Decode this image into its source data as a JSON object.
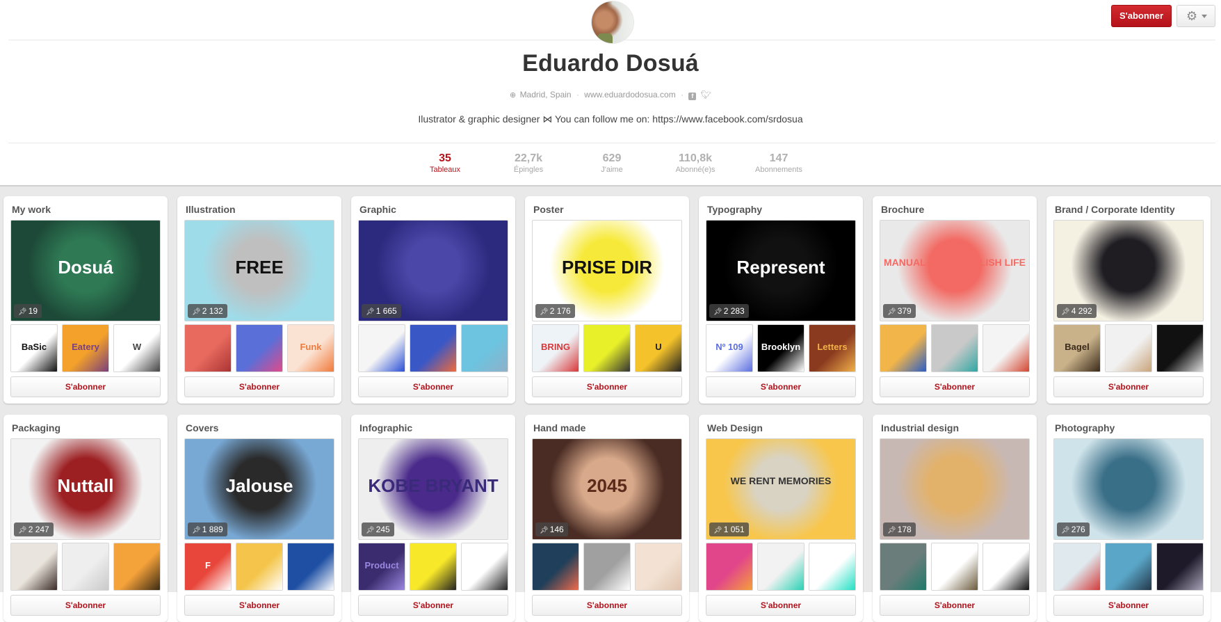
{
  "header": {
    "follow_label": "S'abonner",
    "settings_icon": "gear-icon",
    "avatar_icon": "profile-photo"
  },
  "profile": {
    "name": "Eduardo Dosuá",
    "location_icon": "globe-icon",
    "location": "Madrid, Spain",
    "website": "www.eduardodosua.com",
    "social_icons": [
      "facebook-icon",
      "twitter-icon"
    ],
    "bio": "Ilustrator & graphic designer ⋈ You can follow me on: https://www.facebook.com/srdosua"
  },
  "stats": [
    {
      "value": "35",
      "label": "Tableaux",
      "active": true
    },
    {
      "value": "22,7k",
      "label": "Épingles",
      "active": false
    },
    {
      "value": "629",
      "label": "J'aime",
      "active": false
    },
    {
      "value": "110,8k",
      "label": "Abonné(e)s",
      "active": false
    },
    {
      "value": "147",
      "label": "Abonnements",
      "active": false
    }
  ],
  "board_follow_label": "S'abonner",
  "pin_icon": "pushpin-icon",
  "boards": [
    {
      "title": "My work",
      "pins": "19",
      "cover_colors": [
        "#1d4a38",
        "#2f7a55"
      ],
      "cover_text": "Dosuá",
      "cover_text_color": "#ffffff",
      "thumbs": [
        [
          "#ffffff",
          "#111111",
          "BaSic"
        ],
        [
          "#f3a12a",
          "#7a3f7c",
          "Eatery"
        ],
        [
          "#ffffff",
          "#444444",
          "W"
        ]
      ]
    },
    {
      "title": "Illustration",
      "pins": "2 132",
      "cover_colors": [
        "#9fdcea",
        "#bfbfbf"
      ],
      "cover_text": "FREE",
      "cover_text_color": "#111111",
      "thumbs": [
        [
          "#e86a5f",
          "#a33",
          ""
        ],
        [
          "#5a6fd8",
          "#e04a8a",
          ""
        ],
        [
          "#fbe3d3",
          "#f07a3a",
          "Funk"
        ]
      ]
    },
    {
      "title": "Graphic",
      "pins": "1 665",
      "cover_colors": [
        "#2c2a7e",
        "#4a47a8"
      ],
      "cover_text": "",
      "cover_text_color": "#ffffff",
      "thumbs": [
        [
          "#f5f5f5",
          "#2a4fd6",
          ""
        ],
        [
          "#3a57c6",
          "#f06a3a",
          ""
        ],
        [
          "#6cc4e0",
          "#8fb0c8",
          ""
        ]
      ]
    },
    {
      "title": "Poster",
      "pins": "2 176",
      "cover_colors": [
        "#ffffff",
        "#f7e93a"
      ],
      "cover_text": "PRISE DIR",
      "cover_text_color": "#111111",
      "thumbs": [
        [
          "#eef3f7",
          "#d8383a",
          "BRING"
        ],
        [
          "#e8f02a",
          "#333333",
          ""
        ],
        [
          "#f4c22a",
          "#222222",
          "U"
        ]
      ]
    },
    {
      "title": "Typography",
      "pins": "2 283",
      "cover_colors": [
        "#000000",
        "#111111"
      ],
      "cover_text": "Represent",
      "cover_text_color": "#ffffff",
      "thumbs": [
        [
          "#ffffff",
          "#5b6ee0",
          "Nº 109"
        ],
        [
          "#000000",
          "#ffffff",
          "Brooklyn"
        ],
        [
          "#8a3a1f",
          "#f2b14a",
          "Letters"
        ]
      ]
    },
    {
      "title": "Brochure",
      "pins": "379",
      "cover_colors": [
        "#e9e9e9",
        "#f26a63"
      ],
      "cover_text": "MANUAL FOR A STYLISH LIFE",
      "cover_text_color": "#f26a63",
      "thumbs": [
        [
          "#f2b54a",
          "#2a5ec7",
          ""
        ],
        [
          "#c9c9c9",
          "#2fa7a3",
          ""
        ],
        [
          "#f4f4f4",
          "#d4452f",
          ""
        ]
      ]
    },
    {
      "title": "Brand / Corporate Identity",
      "pins": "4 292",
      "cover_colors": [
        "#f4f0e2",
        "#1f1c22"
      ],
      "cover_text": "",
      "cover_text_color": "#f2d23a",
      "thumbs": [
        [
          "#c9b28a",
          "#3a2a1a",
          "Bagel"
        ],
        [
          "#f1f1f1",
          "#c9a47a",
          ""
        ],
        [
          "#111111",
          "#dddddd",
          ""
        ]
      ]
    },
    {
      "title": "Packaging",
      "pins": "2 247",
      "cover_colors": [
        "#f2f2f2",
        "#9c1f22"
      ],
      "cover_text": "Nuttall",
      "cover_text_color": "#ffffff",
      "thumbs": [
        [
          "#e9e4dd",
          "#3a2a24",
          ""
        ],
        [
          "#eeeeee",
          "#c9c9c9",
          ""
        ],
        [
          "#f4a23a",
          "#3a2a14",
          ""
        ]
      ]
    },
    {
      "title": "Covers",
      "pins": "1 889",
      "cover_colors": [
        "#78a8d4",
        "#2a2a2a"
      ],
      "cover_text": "Jalouse",
      "cover_text_color": "#ffffff",
      "thumbs": [
        [
          "#e8463a",
          "#ffffff",
          "F"
        ],
        [
          "#f4c54a",
          "#ffffff",
          ""
        ],
        [
          "#1e4fa3",
          "#ffffff",
          ""
        ]
      ]
    },
    {
      "title": "Infographic",
      "pins": "245",
      "cover_colors": [
        "#eeeeee",
        "#4a2a8a"
      ],
      "cover_text": "KOBE BRYANT",
      "cover_text_color": "#3a2a7a",
      "thumbs": [
        [
          "#3a2c6e",
          "#9a88e0",
          "Product"
        ],
        [
          "#f8e82a",
          "#222222",
          ""
        ],
        [
          "#ffffff",
          "#222222",
          ""
        ]
      ]
    },
    {
      "title": "Hand made",
      "pins": "146",
      "cover_colors": [
        "#4a2c24",
        "#d8a98a"
      ],
      "cover_text": "2045",
      "cover_text_color": "#5a2a1a",
      "thumbs": [
        [
          "#1f3f5a",
          "#f06a4a",
          ""
        ],
        [
          "#a0a0a0",
          "#ffffff",
          ""
        ],
        [
          "#f3e2d3",
          "#e0c4b0",
          ""
        ]
      ]
    },
    {
      "title": "Web Design",
      "pins": "1 051",
      "cover_colors": [
        "#f8c64a",
        "#d9d3c4"
      ],
      "cover_text": "WE RENT MEMORIES",
      "cover_text_color": "#333333",
      "thumbs": [
        [
          "#e2468a",
          "#f4a03a",
          ""
        ],
        [
          "#f2f2f2",
          "#2ad1b4",
          ""
        ],
        [
          "#ffffff",
          "#22e0c4",
          ""
        ]
      ]
    },
    {
      "title": "Industrial design",
      "pins": "178",
      "cover_colors": [
        "#c8b8b4",
        "#e3b26a"
      ],
      "cover_text": "",
      "cover_text_color": "#333333",
      "thumbs": [
        [
          "#6a7d7a",
          "#1f7a6a",
          ""
        ],
        [
          "#ffffff",
          "#6a5a3a",
          ""
        ],
        [
          "#ffffff",
          "#111111",
          ""
        ]
      ]
    },
    {
      "title": "Photography",
      "pins": "276",
      "cover_colors": [
        "#cfe3ea",
        "#3a6f88"
      ],
      "cover_text": "",
      "cover_text_color": "#ffffff",
      "thumbs": [
        [
          "#dfe9ee",
          "#d43a3a",
          ""
        ],
        [
          "#5aa6c8",
          "#24384a",
          ""
        ],
        [
          "#1f1a2a",
          "#a8a4b8",
          ""
        ]
      ]
    }
  ]
}
